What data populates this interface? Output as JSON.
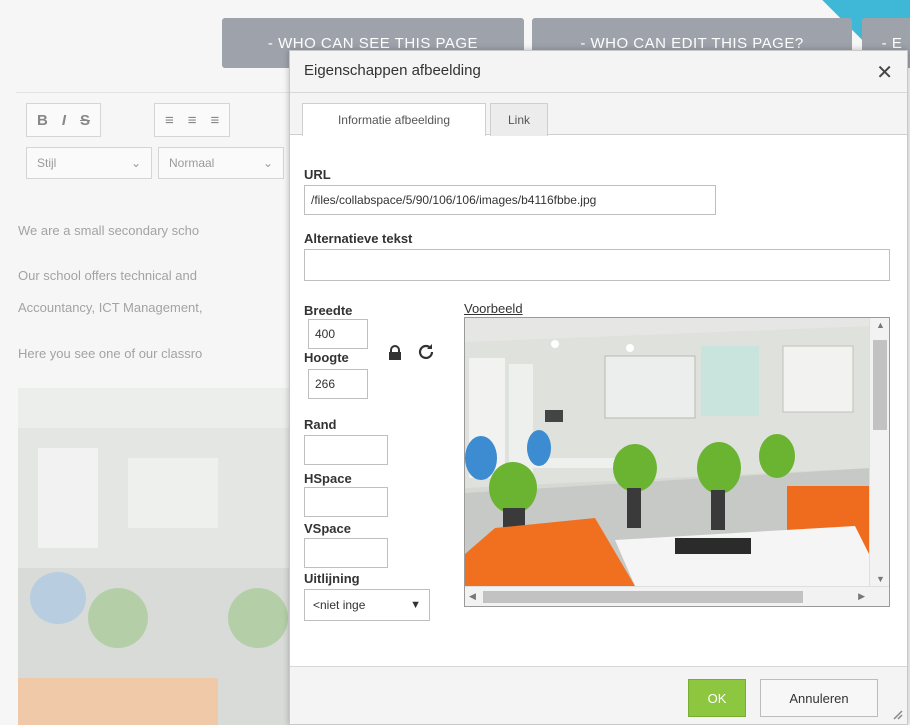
{
  "background_page": {
    "top_buttons": [
      "- WHO CAN SEE THIS PAGE",
      "- WHO CAN EDIT THIS PAGE?",
      "- E"
    ],
    "toolbar": {
      "bold": "B",
      "italic": "I",
      "strike": "S",
      "style_select": "Stijl",
      "format_select": "Normaal"
    },
    "paragraphs": [
      "We are a small secondary scho",
      "Our school offers technical and",
      "Accountancy, ICT Management,",
      "Here you see one of our classro"
    ]
  },
  "dialog": {
    "title": "Eigenschappen afbeelding",
    "tabs": [
      "Informatie afbeelding",
      "Link"
    ],
    "url_label": "URL",
    "url_value": "/files/collabspace/5/90/106/106/images/b4116fbbe.jpg",
    "alt_label": "Alternatieve tekst",
    "alt_value": "",
    "width_label": "Breedte",
    "width_value": "400",
    "height_label": "Hoogte",
    "height_value": "266",
    "border_label": "Rand",
    "hspace_label": "HSpace",
    "vspace_label": "VSpace",
    "align_label": "Uitlijning",
    "align_value": "<niet inge",
    "preview_label": "Voorbeeld",
    "ok_label": "OK",
    "cancel_label": "Annuleren"
  },
  "colors": {
    "ok_button": "#8dc63f",
    "top_buttons": "#9da2ab",
    "accent_corner": "#3fb8d8"
  },
  "icons": [
    "close-icon",
    "lock-icon",
    "reset-icon",
    "dropdown-arrow-icon",
    "resize-grip-icon"
  ]
}
